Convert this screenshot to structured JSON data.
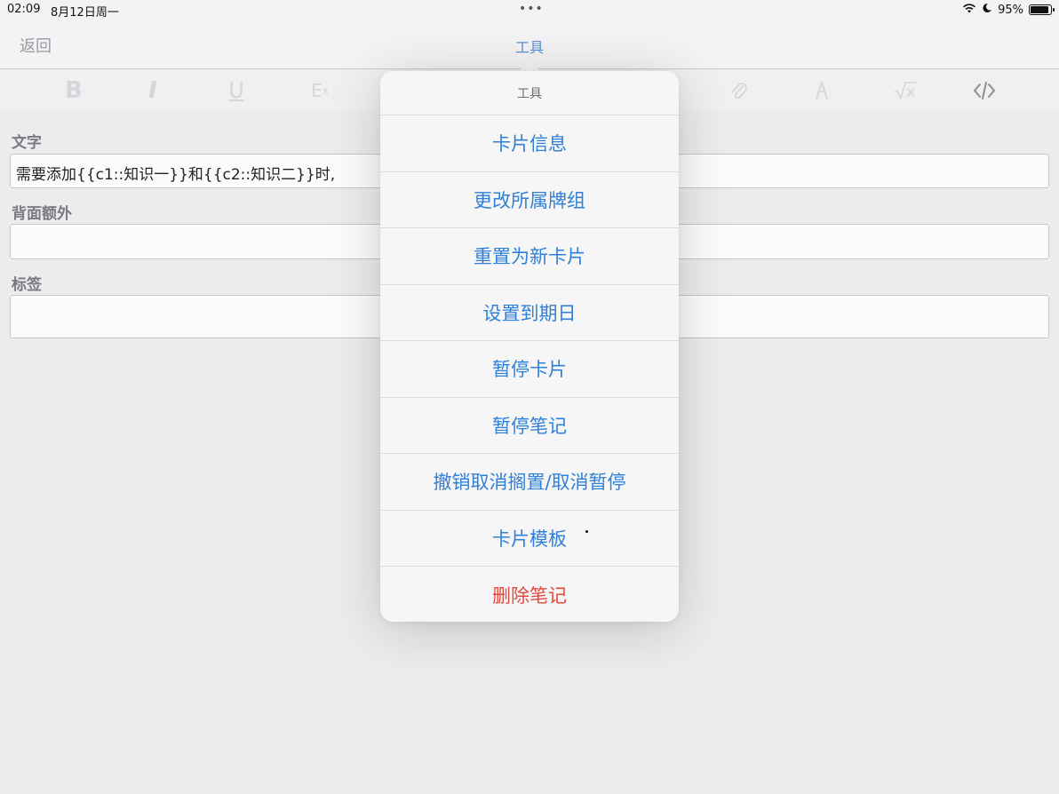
{
  "status_bar": {
    "time": "02:09",
    "date": "8月12日周一",
    "dots": "•••",
    "battery_percent": "95%",
    "battery_level": 0.95
  },
  "nav": {
    "back_label": "返回",
    "title": "工具"
  },
  "toolbar": {
    "bold": "B",
    "italic": "I",
    "underline": "U",
    "ex": "E",
    "ex_sub": "x"
  },
  "fields": [
    {
      "label": "文字",
      "value": "需要添加{{c1::知识一}}和{{c2::知识二}}时,"
    },
    {
      "label": "背面额外",
      "value": ""
    },
    {
      "label": "标签",
      "value": ""
    }
  ],
  "popover": {
    "title": "工具",
    "items": [
      {
        "label": "卡片信息",
        "destructive": false
      },
      {
        "label": "更改所属牌组",
        "destructive": false
      },
      {
        "label": "重置为新卡片",
        "destructive": false
      },
      {
        "label": "设置到期日",
        "destructive": false
      },
      {
        "label": "暂停卡片",
        "destructive": false
      },
      {
        "label": "暂停笔记",
        "destructive": false
      },
      {
        "label": "撤销取消搁置/取消暂停",
        "destructive": false
      },
      {
        "label": "卡片模板",
        "destructive": false
      },
      {
        "label": "删除笔记",
        "destructive": true
      }
    ]
  },
  "colors": {
    "accent": "#2f80d8",
    "destructive": "#e2483d",
    "nav_title": "#5a8fd0"
  }
}
